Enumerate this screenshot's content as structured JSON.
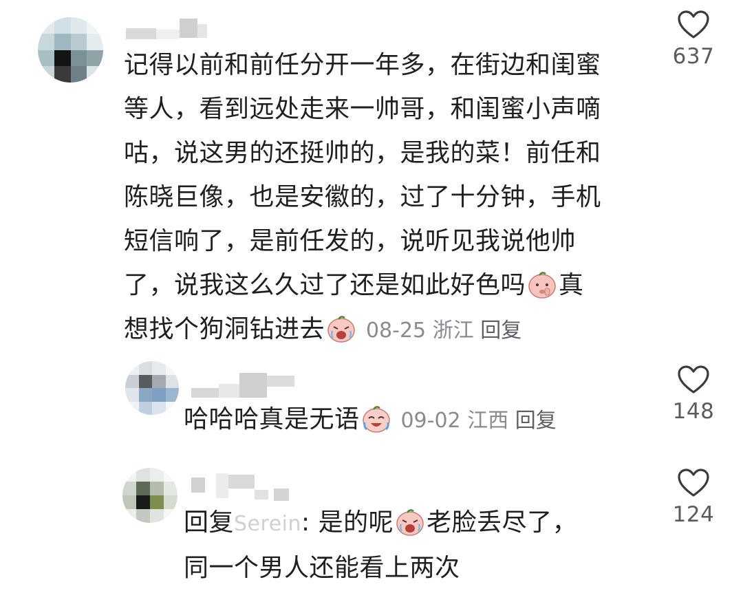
{
  "comments": [
    {
      "text": "记得以前和前任分开一年多，在街边和闺蜜等人，看到远处走来一帅哥，和闺蜜小声嘀咕，说这男的还挺帅的，是我的菜！前任和陈晓巨像，也是安徽的，过了十分钟，手机短信响了，是前任发的，说听见我说他帅了，说我这么久过了还是如此好色吗",
      "text_tail": "真想找个狗洞钻进去",
      "lines": [
        "记得以前和前任分开一年多，在街边和闺蜜",
        "等人，看到远处走来一帅哥，和闺蜜小声嘀",
        "咕，说这男的还挺帅的，是我的菜！前任和",
        "陈晓巨像，也是安徽的，过了十分钟，手机",
        "短信响了，是前任发的，说听见我说他帅",
        "了，说我这么久过了还是如此好色吗",
        "真"
      ],
      "line_last": "想找个狗洞钻进去",
      "date": "08-25",
      "location": "浙江",
      "reply_label": "回复",
      "likes": "637",
      "emoji_inline": "shush-face",
      "emoji_end": "crying-face"
    },
    {
      "text": "哈哈哈真是无语",
      "date": "09-02",
      "location": "江西",
      "reply_label": "回复",
      "likes": "148",
      "emoji_end": "laugh-cry-face"
    },
    {
      "reply_prefix": "回复",
      "mention_fragment": "Serein",
      "text_a": ": 是的呢",
      "text_b": "老脸丢尽了，",
      "text_c": "同一个男人还能看上两次",
      "likes": "124",
      "emoji_inline": "crying-face"
    }
  ],
  "colors": {
    "text": "#1f1f1f",
    "meta": "#8a8b91",
    "like_icon": "#3a3b40",
    "like_count": "#5a5b60"
  },
  "icons": {
    "like": "heart-outline-icon"
  }
}
